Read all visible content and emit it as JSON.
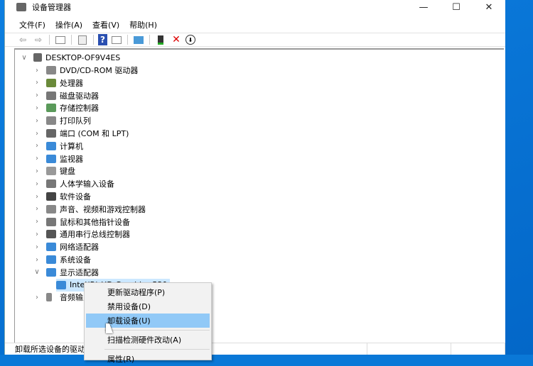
{
  "window": {
    "title": "设备管理器",
    "minimize": "—",
    "maximize": "☐",
    "close": "✕"
  },
  "menubar": [
    "文件(F)",
    "操作(A)",
    "查看(V)",
    "帮助(H)"
  ],
  "toolbar": {
    "back": "⇦",
    "forward": "⇨",
    "help": "?",
    "remove": "✕",
    "down": "⬇"
  },
  "tree": {
    "root": "DESKTOP-OF9V4ES",
    "items": [
      {
        "label": "DVD/CD-ROM 驱动器",
        "color": "#888"
      },
      {
        "label": "处理器",
        "color": "#6a8a3a"
      },
      {
        "label": "磁盘驱动器",
        "color": "#777"
      },
      {
        "label": "存储控制器",
        "color": "#5a9a5a"
      },
      {
        "label": "打印队列",
        "color": "#888"
      },
      {
        "label": "端口 (COM 和 LPT)",
        "color": "#666"
      },
      {
        "label": "计算机",
        "color": "#3a8ad8"
      },
      {
        "label": "监视器",
        "color": "#3a8ad8"
      },
      {
        "label": "键盘",
        "color": "#999"
      },
      {
        "label": "人体学输入设备",
        "color": "#777"
      },
      {
        "label": "软件设备",
        "color": "#444"
      },
      {
        "label": "声音、视频和游戏控制器",
        "color": "#888"
      },
      {
        "label": "鼠标和其他指针设备",
        "color": "#777"
      },
      {
        "label": "通用串行总线控制器",
        "color": "#555"
      },
      {
        "label": "网络适配器",
        "color": "#3a8ad8"
      },
      {
        "label": "系统设备",
        "color": "#3a8ad8"
      },
      {
        "label": "显示适配器",
        "color": "#3a8ad8"
      }
    ],
    "child": "Intel(R) HD Graphics 530",
    "after": "音频输入和输出"
  },
  "context_menu": [
    "更新驱动程序(P)",
    "禁用设备(D)",
    "卸载设备(U)",
    "扫描检测硬件改动(A)",
    "属性(R)"
  ],
  "status": "卸载所选设备的驱动程序。"
}
